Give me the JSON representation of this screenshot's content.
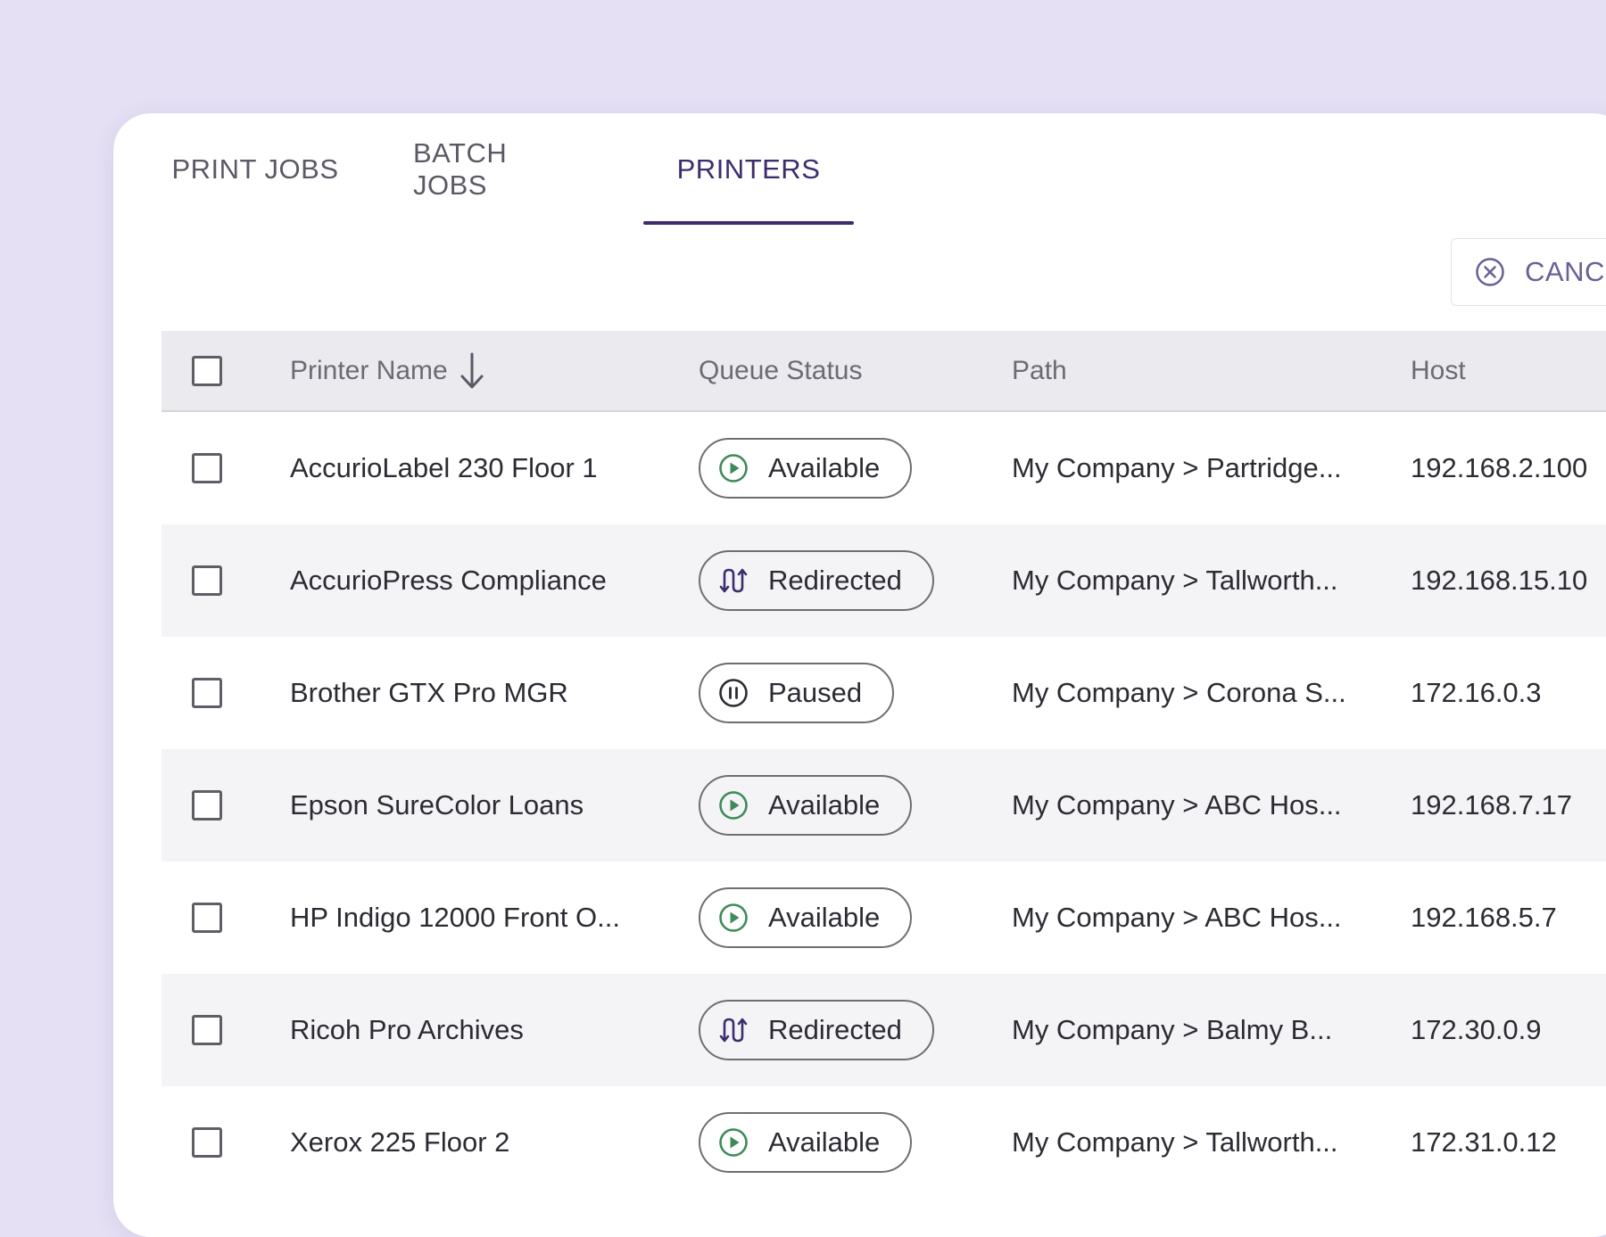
{
  "tabs": [
    {
      "label": "PRINT JOBS",
      "active": false
    },
    {
      "label": "BATCH JOBS",
      "active": false
    },
    {
      "label": "PRINTERS",
      "active": true
    }
  ],
  "toolbar": {
    "cancel_label": "CANC",
    "cancel_icon": "close-circle-icon"
  },
  "table": {
    "columns": [
      {
        "label": "Printer Name",
        "sort": "descending",
        "sort_icon": "arrow-down-icon"
      },
      {
        "label": "Queue Status"
      },
      {
        "label": "Path"
      },
      {
        "label": "Host"
      }
    ],
    "rows": [
      {
        "name": "AccurioLabel 230 Floor 1",
        "status": "Available",
        "status_icon": "play-circle-icon",
        "path": "My Company > Partridge...",
        "host": "192.168.2.100"
      },
      {
        "name": "AccurioPress Compliance",
        "status": "Redirected",
        "status_icon": "redirect-icon",
        "path": "My Company > Tallworth...",
        "host": "192.168.15.10"
      },
      {
        "name": "Brother GTX Pro MGR",
        "status": "Paused",
        "status_icon": "pause-circle-icon",
        "path": "My Company > Corona S...",
        "host": "172.16.0.3"
      },
      {
        "name": "Epson SureColor Loans",
        "status": "Available",
        "status_icon": "play-circle-icon",
        "path": "My Company > ABC Hos...",
        "host": "192.168.7.17"
      },
      {
        "name": "HP Indigo 12000 Front O...",
        "status": "Available",
        "status_icon": "play-circle-icon",
        "path": "My Company > ABC Hos...",
        "host": "192.168.5.7"
      },
      {
        "name": "Ricoh Pro Archives",
        "status": "Redirected",
        "status_icon": "redirect-icon",
        "path": "My Company > Balmy B...",
        "host": "172.30.0.9"
      },
      {
        "name": "Xerox 225 Floor 2",
        "status": "Available",
        "status_icon": "play-circle-icon",
        "path": "My Company > Tallworth...",
        "host": "172.31.0.12"
      }
    ]
  },
  "colors": {
    "background": "#e5e0f4",
    "accent": "#3d2c6e",
    "available_icon": "#3e8a5a",
    "redirect_icon": "#3d2c6e",
    "paused_icon": "#2b2b33"
  }
}
